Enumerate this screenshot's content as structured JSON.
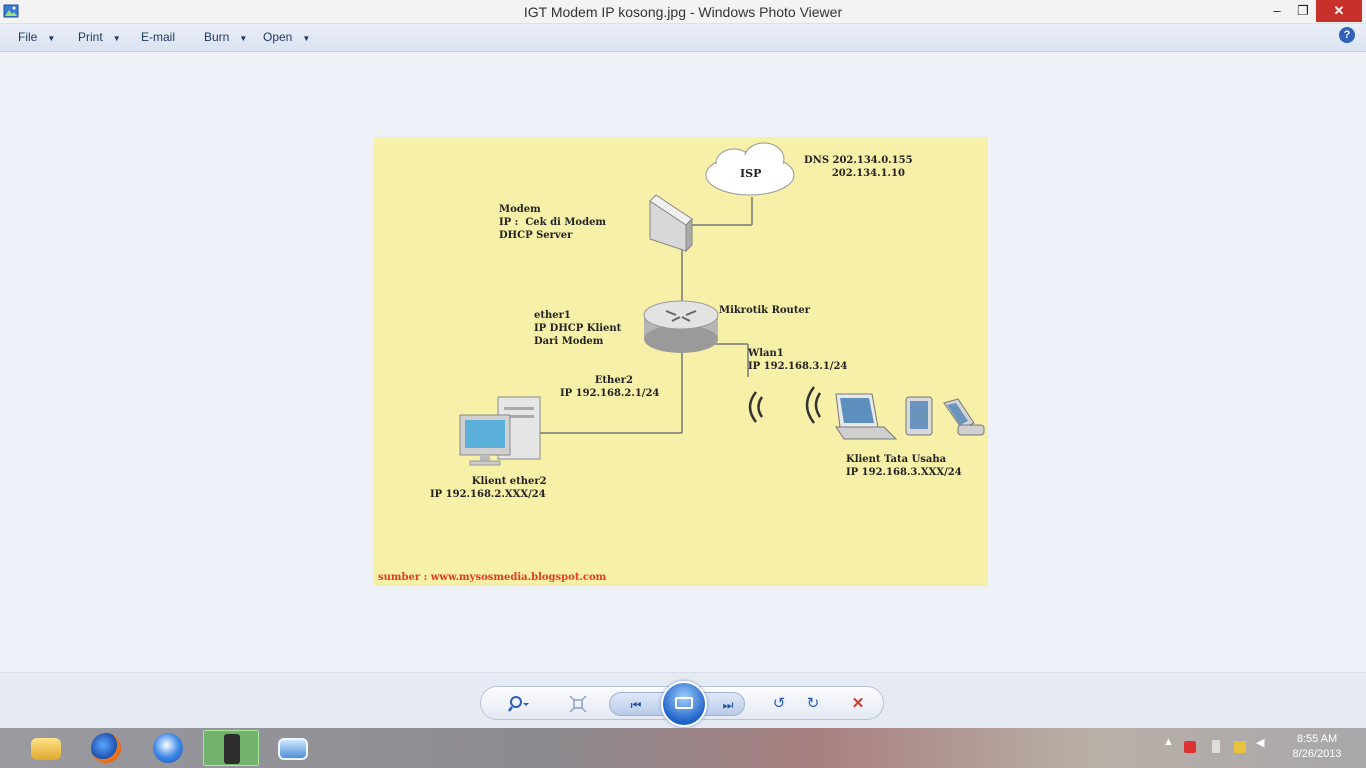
{
  "window": {
    "title": "IGT Modem IP kosong.jpg - Windows Photo Viewer",
    "minimize_glyph": "‒",
    "maximize_glyph": "❐",
    "close_glyph": "✕"
  },
  "menu": {
    "items": [
      "File",
      "Print",
      "E-mail",
      "Burn",
      "Open"
    ],
    "help_glyph": "?"
  },
  "diagram": {
    "isp": "ISP",
    "dns": "DNS 202.134.0.155\n        202.134.1.10",
    "modem": "Modem\nIP :  Cek di Modem\nDHCP Server",
    "router": "Mikrotik Router",
    "ether1": "ether1\nIP DHCP Klient\nDari Modem",
    "wlan1": "Wlan1\nIP 192.168.3.1/24",
    "ether2": "          Ether2\nIP 192.168.2.1/24",
    "klient_ether2": "            Klient ether2\nIP 192.168.2.XXX/24",
    "klient_tu": "Klient Tata Usaha\nIP 192.168.3.XXX/24",
    "source": "sumber : www.mysosmedia.blogspot.com"
  },
  "controls": {
    "zoom_icon": "magnifier-icon",
    "fit_icon": "actual-size-icon",
    "prev_glyph": "⏮",
    "next_glyph": "⏭",
    "rotate_ccw_glyph": "↺",
    "rotate_cw_glyph": "↻",
    "delete_glyph": "✕"
  },
  "taskbar": {
    "clock_time": "8:55 AM",
    "clock_date": "8/26/2013",
    "tray_up_glyph": "▲"
  },
  "colors": {
    "diagram_bg": "#f7f0a9",
    "source_text": "#e33b1c",
    "close_button": "#c7302b",
    "accent": "#2f62b8"
  }
}
